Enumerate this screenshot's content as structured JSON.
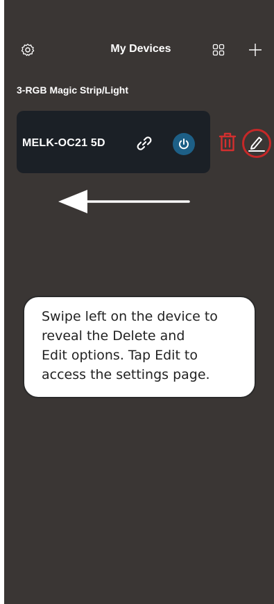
{
  "header": {
    "title": "My Devices",
    "settings_icon": "gear-icon",
    "grid_icon": "grid-view-icon",
    "add_icon": "plus-icon"
  },
  "group": {
    "label": "3-RGB Magic Strip/Light"
  },
  "device": {
    "name": "MELK-OC21 5D",
    "link_icon": "link-icon",
    "power_icon": "power-icon"
  },
  "actions": {
    "delete_icon": "trash-icon",
    "edit_icon": "edit-pencil-icon"
  },
  "tutorial": {
    "instruction_lines": [
      "Swipe left on the device to",
      "reveal the Delete and",
      "Edit options. Tap Edit to",
      "access the settings page."
    ],
    "gesture_icon": "swipe-left-arrow-icon"
  },
  "colors": {
    "background": "#3a3634",
    "card": "#1b2026",
    "power_button": "#1d5f86",
    "delete": "#d32f2f",
    "highlight": "#c62828"
  }
}
